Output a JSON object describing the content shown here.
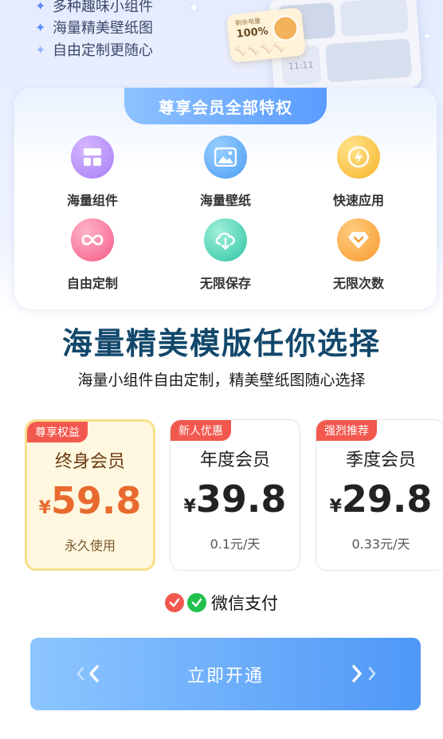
{
  "hero": {
    "features": [
      "多种趣味小组件",
      "海量精美壁纸图",
      "自由定制更随心"
    ],
    "battery_widget": {
      "label": "剩余电量",
      "value": "100%"
    },
    "phone_clock": "11:11"
  },
  "benefits": {
    "title": "尊享会员全部特权",
    "items": [
      {
        "label": "海量组件",
        "icon": "widget-grid-icon",
        "color": "#a97cf6"
      },
      {
        "label": "海量壁纸",
        "icon": "image-icon",
        "color": "#4a9cf5"
      },
      {
        "label": "快速应用",
        "icon": "lightning-icon",
        "color": "#f7b32b"
      },
      {
        "label": "自由定制",
        "icon": "infinity-icon",
        "color": "#f45b86"
      },
      {
        "label": "无限保存",
        "icon": "cloud-download-icon",
        "color": "#2ec4a6"
      },
      {
        "label": "无限次数",
        "icon": "diamond-icon",
        "color": "#f79a2c"
      }
    ]
  },
  "headline": "海量精美模版任你选择",
  "subline": "海量小组件自由定制，精美壁纸图随心选择",
  "plans": [
    {
      "badge": "尊享权益",
      "name": "终身会员",
      "currency": "¥",
      "price": "59.8",
      "note": "永久使用",
      "selected": true
    },
    {
      "badge": "新人优惠",
      "name": "年度会员",
      "currency": "¥",
      "price": "39.8",
      "note": "0.1元/天",
      "selected": false
    },
    {
      "badge": "强烈推荐",
      "name": "季度会员",
      "currency": "¥",
      "price": "29.8",
      "note": "0.33元/天",
      "selected": false
    }
  ],
  "payment": {
    "label": "微信支付",
    "colors": {
      "alipay": "#f2584e",
      "wechat": "#22c04c"
    }
  },
  "cta": {
    "label": "立即开通"
  },
  "colors": {
    "accent": "#5a9cff",
    "badge": "#f2584e",
    "headline": "#12486b",
    "selected_price": "#e86a2e"
  }
}
